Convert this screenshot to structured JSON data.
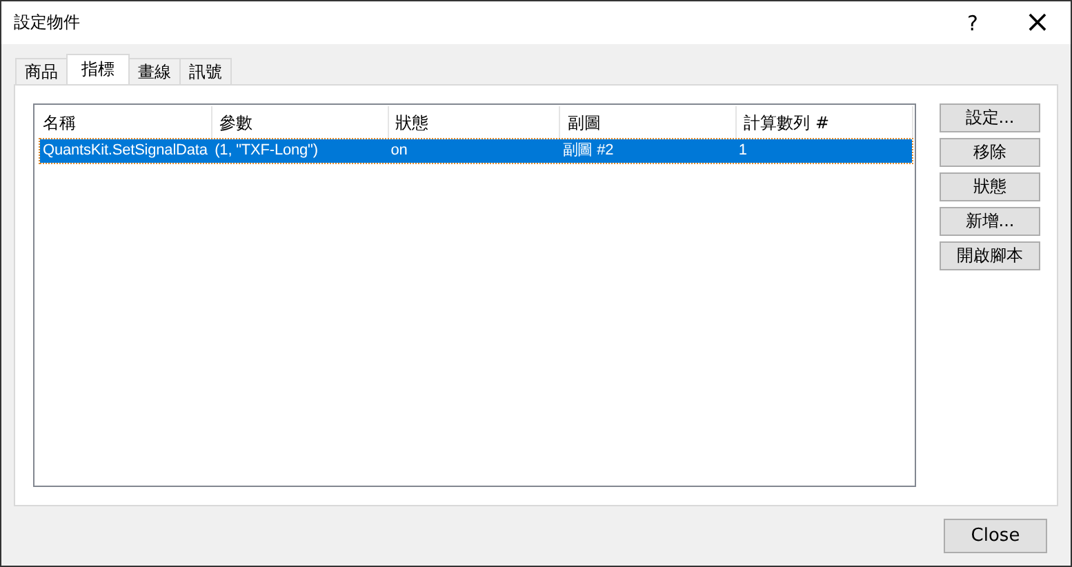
{
  "window": {
    "title": "設定物件",
    "help": "?",
    "close": "×"
  },
  "tabs": [
    {
      "label": "商品",
      "selected": false
    },
    {
      "label": "指標",
      "selected": true
    },
    {
      "label": "畫線",
      "selected": false
    },
    {
      "label": "訊號",
      "selected": false
    }
  ],
  "table": {
    "columns": [
      "名稱",
      "參數",
      "狀態",
      "副圖",
      "計算數列 #"
    ],
    "rows": [
      {
        "cells": [
          "QuantsKit.SetSignalData",
          "(1, \"TXF-Long\")",
          "on",
          "副圖 #2",
          "1"
        ],
        "selected": true
      }
    ]
  },
  "side_buttons": [
    "設定...",
    "移除",
    "狀態",
    "新增...",
    "開啟腳本"
  ],
  "footer_button": "Close"
}
